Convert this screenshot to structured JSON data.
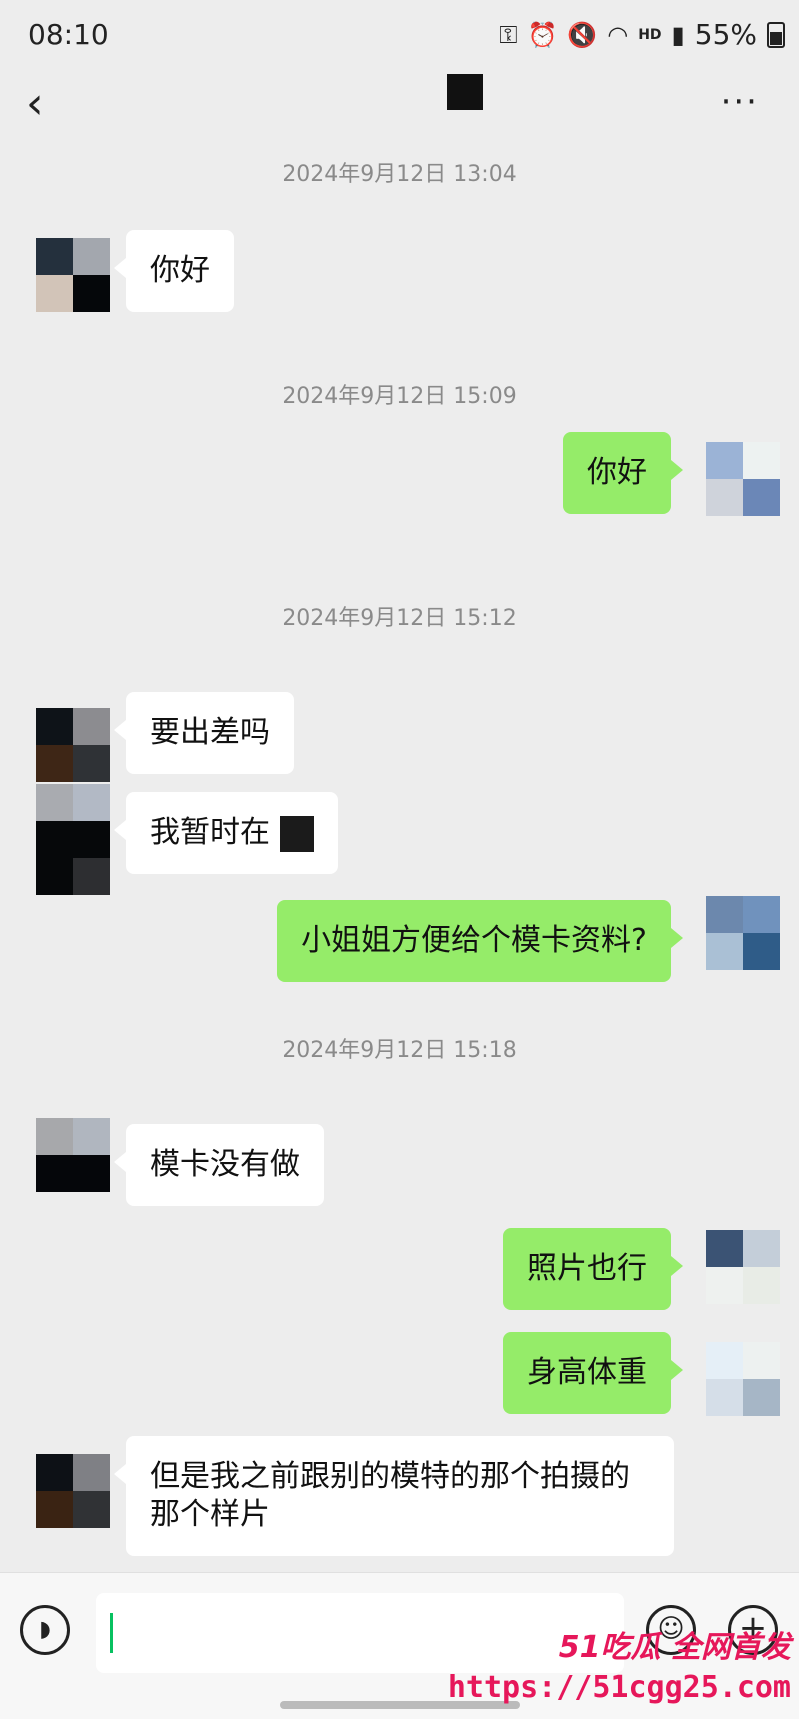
{
  "status": {
    "time": "08:10",
    "battery": "55%",
    "network": "HD"
  },
  "nav": {
    "back": "‹",
    "more": "···"
  },
  "messages": {
    "ts1": "2024年9月12日 13:04",
    "m1": "你好",
    "ts2": "2024年9月12日 15:09",
    "m2": "你好",
    "ts3": "2024年9月12日 15:12",
    "m3": "要出差吗",
    "m4": "我暂时在",
    "m5": "小姐姐方便给个模卡资料?",
    "ts4": "2024年9月12日 15:18",
    "m6": "模卡没有做",
    "m7": "照片也行",
    "m8": "身高体重",
    "m9": "但是我之前跟别的模特的那个拍摄的那个样片"
  },
  "input": {
    "value": ""
  },
  "watermark": {
    "brand": "51吃瓜 全网首发",
    "url": "https://51cgg25.com"
  },
  "colors": {
    "bubble_sent": "#95ec69",
    "bubble_received": "#ffffff",
    "background": "#ededed",
    "watermark": "#e6175a"
  }
}
